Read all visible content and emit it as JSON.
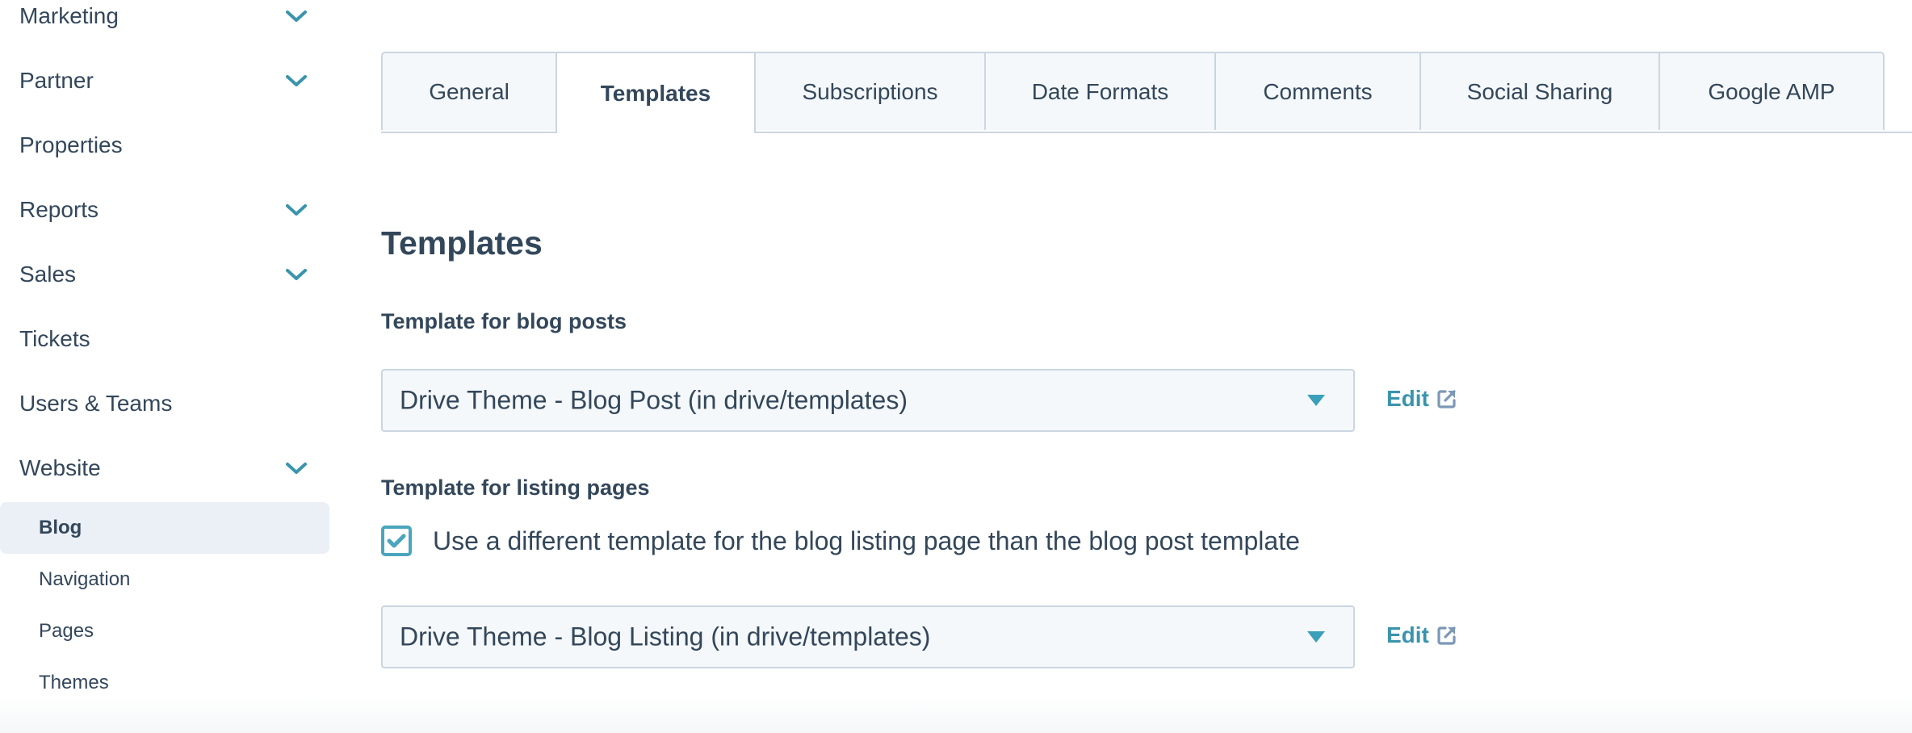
{
  "sidebar": {
    "items": [
      {
        "label": "Marketing",
        "expandable": true
      },
      {
        "label": "Partner",
        "expandable": true
      },
      {
        "label": "Properties",
        "expandable": false
      },
      {
        "label": "Reports",
        "expandable": true
      },
      {
        "label": "Sales",
        "expandable": true
      },
      {
        "label": "Tickets",
        "expandable": false
      },
      {
        "label": "Users & Teams",
        "expandable": false
      },
      {
        "label": "Website",
        "expandable": true,
        "expanded": true
      }
    ],
    "website_subitems": [
      {
        "label": "Blog",
        "active": true
      },
      {
        "label": "Navigation",
        "active": false
      },
      {
        "label": "Pages",
        "active": false
      },
      {
        "label": "Themes",
        "active": false
      }
    ]
  },
  "tabs": [
    {
      "label": "General",
      "active": false
    },
    {
      "label": "Templates",
      "active": true
    },
    {
      "label": "Subscriptions",
      "active": false
    },
    {
      "label": "Date Formats",
      "active": false
    },
    {
      "label": "Comments",
      "active": false
    },
    {
      "label": "Social Sharing",
      "active": false
    },
    {
      "label": "Google AMP",
      "active": false
    }
  ],
  "main": {
    "section_title": "Templates",
    "blog_posts": {
      "label": "Template for blog posts",
      "selected": "Drive Theme - Blog Post (in drive/templates)",
      "edit_label": "Edit"
    },
    "listing_pages": {
      "label": "Template for listing pages",
      "checkbox_label": "Use a different template for the blog listing page than the blog post template",
      "checkbox_checked": true,
      "selected": "Drive Theme - Blog Listing (in drive/templates)",
      "edit_label": "Edit"
    }
  },
  "icons": {
    "chevron": "chevron-down-icon",
    "caret": "caret-down-icon",
    "external_link": "external-link-icon",
    "checkmark": "checkmark-icon"
  },
  "colors": {
    "text": "#33475b",
    "accent": "#3a94ad",
    "active_nav_bg": "#eaf0f6",
    "tab_bg": "#f5f8fa",
    "border": "#cbd6e2",
    "external_icon": "#7c98b6"
  }
}
